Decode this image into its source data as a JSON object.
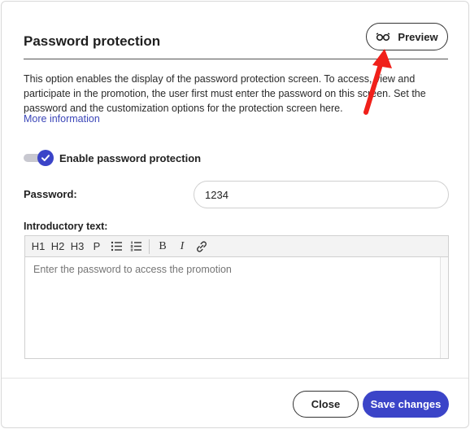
{
  "modal": {
    "title": "Password protection",
    "preview_button": {
      "label": "Preview",
      "icon": "glasses-icon"
    },
    "description": "This option enables the display of the password protection screen. To access, view and participate in the promotion, the user first must enter the password on this screen. Set the password and the customization options for the protection screen here.",
    "more_info_link": "More information",
    "toggle": {
      "label": "Enable password protection",
      "checked": true
    },
    "password": {
      "label": "Password:",
      "value": "1234"
    },
    "intro": {
      "label": "Introductory text:",
      "placeholder": "Enter the password to access the promotion",
      "toolbar": {
        "h1": "H1",
        "h2": "H2",
        "h3": "H3",
        "p": "P",
        "bullet_list": "bulleted-list-icon",
        "numbered_list": "numbered-list-icon",
        "bold": "B",
        "italic": "I",
        "link": "link-icon"
      }
    },
    "footer": {
      "close_label": "Close",
      "save_label": "Save changes"
    }
  },
  "colors": {
    "accent": "#3b44c8",
    "link": "#3b46b8",
    "annotation_arrow": "#f0201a"
  }
}
